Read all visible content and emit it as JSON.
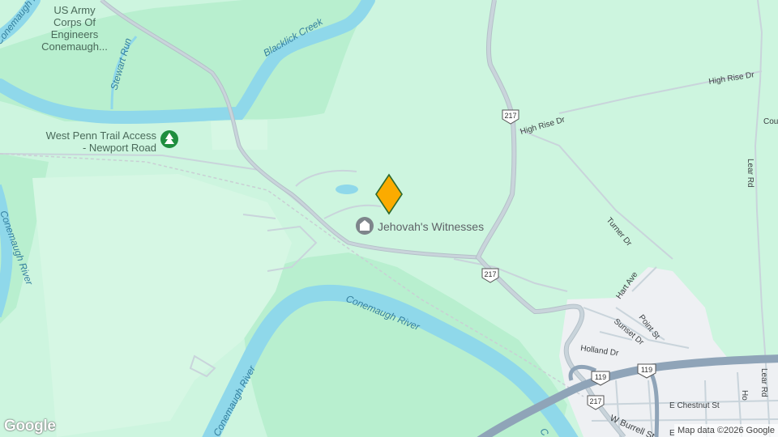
{
  "colors": {
    "land": "#cdf5df",
    "land_light": "#d6f7e4",
    "forest": "#b8efcf",
    "water": "#8fd8ea",
    "water_label": "#35809e",
    "road": "#c9d4db",
    "road_edge": "#b4c0c8",
    "highway": "#8fa4b8",
    "urban": "#eef0f3",
    "street_label": "#3c4043",
    "poi_label": "#5f6368",
    "park_icon": "#1e8e3e",
    "pin_fill": "#fbab00",
    "pin_stroke": "#2d6a2e"
  },
  "places": {
    "army_corps": [
      "US Army",
      "Corps Of",
      "Engineers",
      "Conemaugh..."
    ],
    "trail_access": [
      "West Penn Trail Access",
      "- Newport Road"
    ],
    "jehovah": "Jehovah's Witnesses"
  },
  "icons": {
    "park": "tree-icon",
    "worship": "worship-icon",
    "pin": "location-pin-icon"
  },
  "waterways": {
    "stewart_run": "Stewart Run",
    "blacklick_creek": "Blacklick Creek",
    "conemaugh_top": "Conemaugh River",
    "conemaugh_left": "Conemaugh River",
    "conemaugh_main": "Conemaugh River",
    "conemaugh_bottom": "Conemaugh River",
    "conemaugh_right_edge": "C"
  },
  "streets": {
    "high_rise_upper": "High Rise Dr",
    "high_rise_lower": "High Rise Dr",
    "county": "Cou",
    "lear_upper": "Lear Rd",
    "lear_lower": "Lear Rd",
    "turner": "Turner Dr",
    "hart": "Hart Ave",
    "point": "Point St",
    "sunset": "Sunset Dr",
    "holland": "Holland Dr",
    "e_chestnut": "E Chestnut St",
    "w_burrell": "W Burrell St",
    "e_burrell_fragment": "E",
    "ho_fragment": "Ho"
  },
  "shields": {
    "pa217_north": "217",
    "pa217_mid": "217",
    "pa217_south": "217",
    "us119_left": "119",
    "us119_right": "119"
  },
  "attribution": "Map data ©2026 Google",
  "logo": "Google"
}
